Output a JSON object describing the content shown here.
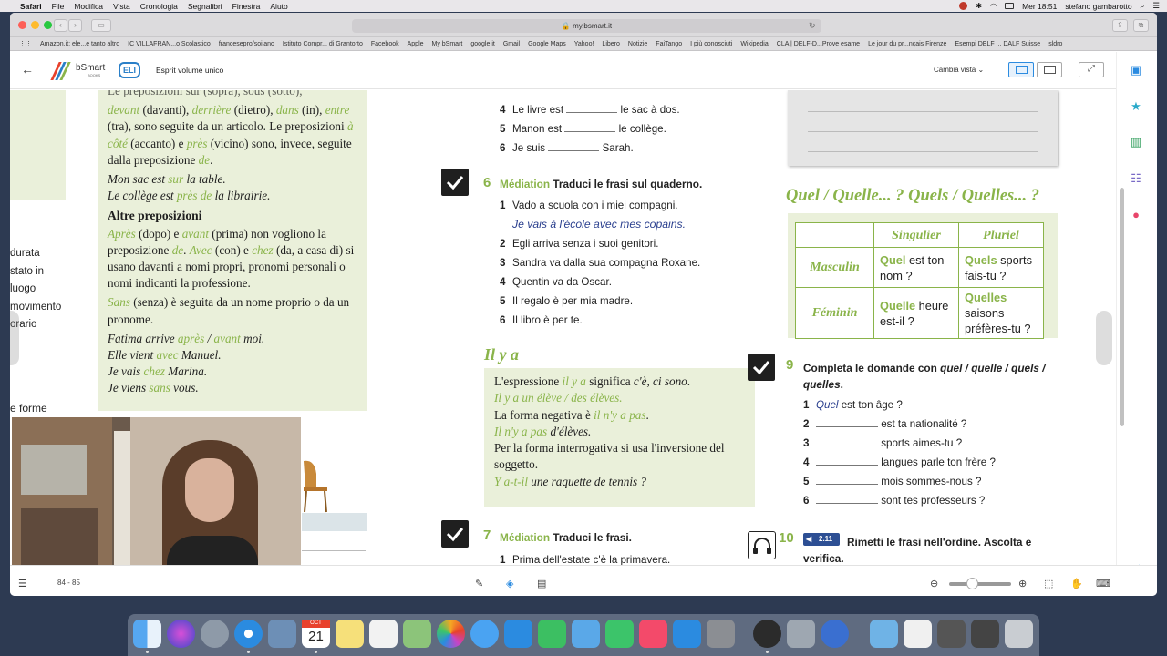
{
  "menubar": {
    "items": [
      "Safari",
      "File",
      "Modifica",
      "Vista",
      "Cronologia",
      "Segnalibri",
      "Finestra",
      "Aiuto"
    ],
    "clock": "Mer 18:51",
    "user": "stefano gambarotto"
  },
  "browser": {
    "url": "my.bsmart.it",
    "bookmarks": [
      "Amazon.it: ele...e tanto altro",
      "IC VILLAFRAN...o Scolastico",
      "francesepro/soilano",
      "Istituto Compr... di Grantorto",
      "Facebook",
      "Apple",
      "My bSmart",
      "google.it",
      "Gmail",
      "Google Maps",
      "Yahoo!",
      "Libero",
      "Notizie",
      "FaiTango",
      "I più conosciuti",
      "Wikipedia",
      "CLA | DELF-D...Prove esame",
      "Le jour du pr...nçais Firenze",
      "Esempi DELF ... DALF Suisse",
      "sldro"
    ]
  },
  "app": {
    "brand": "bSmart",
    "brand_sub": "BOOKS",
    "publisher": "ELI",
    "book_title": "Esprit volume unico",
    "view_label": "Cambia vista",
    "page_range": "84 - 85"
  },
  "left_panel": {
    "top_line": "Le preposizioni sur (sopra), sous (sotto),",
    "p1_kw1": "devant",
    "p1_t1": " (davanti), ",
    "p1_kw2": "derrière",
    "p1_t2": " (dietro), ",
    "p1_kw3": "dans",
    "p1_t3": " (in),",
    "p1_kw4": "entre",
    "p1_t4": " (tra), sono seguite da un articolo. Le preposizioni ",
    "p1_kw5": "à côté",
    "p1_t5": " (accanto) e ",
    "p1_kw6": "près",
    "p1_t6": " (vicino) sono, invece, seguite dalla preposizione ",
    "p1_kw7": "de",
    "p1_t7": ".",
    "ex1_a": "Mon sac est ",
    "ex1_kw": "sur",
    "ex1_b": " la table.",
    "ex2_a": "Le collège est ",
    "ex2_kw": "près de",
    "ex2_b": " la librairie.",
    "heading": "Altre preposizioni",
    "p2_kw1": "Après",
    "p2_t1": " (dopo) e ",
    "p2_kw2": "avant",
    "p2_t2": " (prima) non vogliono la preposizione ",
    "p2_kw3": "de",
    "p2_t3": ". ",
    "p2_kw4": "Avec",
    "p2_t4": " (con) e ",
    "p2_kw5": "chez",
    "p2_t5": " (da, a casa di) si usano davanti a nomi propri, pronomi personali o nomi indicanti la professione.",
    "p3_kw": "Sans",
    "p3_t": " (senza) è seguita da un nome proprio o da un pronome.",
    "ex3_a": "Fatima arrive ",
    "ex3_kw": "après",
    "ex3_sep": " / ",
    "ex3_kw2": "avant",
    "ex3_b": " moi.",
    "ex4_a": "Elle vient ",
    "ex4_kw": "avec",
    "ex4_b": " Manuel.",
    "ex5_a": "Je vais ",
    "ex5_kw": "chez",
    "ex5_b": " Marina.",
    "ex6_a": "Je viens ",
    "ex6_kw": "sans",
    "ex6_b": " vous.",
    "cut_words": [
      "durata",
      "stato in",
      "luogo",
      "movimento",
      "orario"
    ],
    "cut_bottom": "e forme"
  },
  "exercise5_tail": [
    {
      "n": "4",
      "a": "Le livre est",
      "b": "le sac à dos."
    },
    {
      "n": "5",
      "a": "Manon est",
      "b": "le collège."
    },
    {
      "n": "6",
      "a": "Je suis",
      "b": "Sarah."
    }
  ],
  "exercise6": {
    "number": "6",
    "label": "Médiation",
    "instruction": "Traduci le frasi sul quaderno.",
    "answer": "Je vais à l'école avec mes copains.",
    "items": [
      {
        "n": "1",
        "t": "Vado a scuola con i miei compagni."
      },
      {
        "n": "2",
        "t": "Egli arriva senza i suoi genitori."
      },
      {
        "n": "3",
        "t": "Sandra va dalla sua compagna Roxane."
      },
      {
        "n": "4",
        "t": "Quentin va da Oscar."
      },
      {
        "n": "5",
        "t": "Il regalo è per mia madre."
      },
      {
        "n": "6",
        "t": "Il libro è per te."
      }
    ]
  },
  "ilya": {
    "title": "Il y a",
    "l1_a": "L'espressione ",
    "l1_kw": "il y a",
    "l1_b": " significa ",
    "l1_it": "c'è, ci sono",
    "l1_c": ".",
    "l2": "Il y a un élève / des élèves.",
    "l3_a": "La forma negativa è ",
    "l3_kw": "il n'y a pas",
    "l3_b": ".",
    "l4_kw": "Il n'y a pas",
    "l4_b": " d'élèves.",
    "l5": "Per la forma interrogativa si usa l'inversione del soggetto.",
    "l6_kw": "Y a-t-il",
    "l6_b": " une raquette de tennis ?"
  },
  "exercise7": {
    "number": "7",
    "label": "Médiation",
    "instruction": "Traduci le frasi.",
    "items": [
      {
        "n": "1",
        "t": "Prima dell'estate c'è la primavera."
      }
    ]
  },
  "quel": {
    "title": "Quel / Quelle... ? Quels / Quelles... ?",
    "col1": "Singulier",
    "col2": "Pluriel",
    "row1": "Masculin",
    "row2": "Féminin",
    "m_sing_kw": "Quel",
    "m_sing": " est ton nom ?",
    "m_plur_kw": "Quels",
    "m_plur": " sports fais-tu ?",
    "f_sing_kw": "Quelle",
    "f_sing": " heure est-il ?",
    "f_plur_kw": "Quelles",
    "f_plur": " saisons préfères-tu ?"
  },
  "exercise9": {
    "number": "9",
    "instruction_a": "Completa le domande con ",
    "instruction_it": "quel / quelle / quels / quelles",
    "instruction_b": ".",
    "first_answer": "Quel",
    "items": [
      {
        "n": "1",
        "t": "est ton âge ?"
      },
      {
        "n": "2",
        "t": "est ta nationalité ?"
      },
      {
        "n": "3",
        "t": "sports aimes-tu ?"
      },
      {
        "n": "4",
        "t": "langues parle ton frère ?"
      },
      {
        "n": "5",
        "t": "mois sommes-nous ?"
      },
      {
        "n": "6",
        "t": "sont tes professeurs ?"
      }
    ]
  },
  "exercise10": {
    "number": "10",
    "audio": "2.11",
    "instruction": "Rimetti le frasi nell'ordine. Ascolta e verifica."
  },
  "dock": {
    "calendar_month": "OCT",
    "calendar_day": "21"
  },
  "colors": {
    "accent_green": "#8ab44a",
    "panel_bg": "#eaf0da",
    "handwriting_blue": "#2a3f8e",
    "ui_blue": "#2b8be0"
  }
}
